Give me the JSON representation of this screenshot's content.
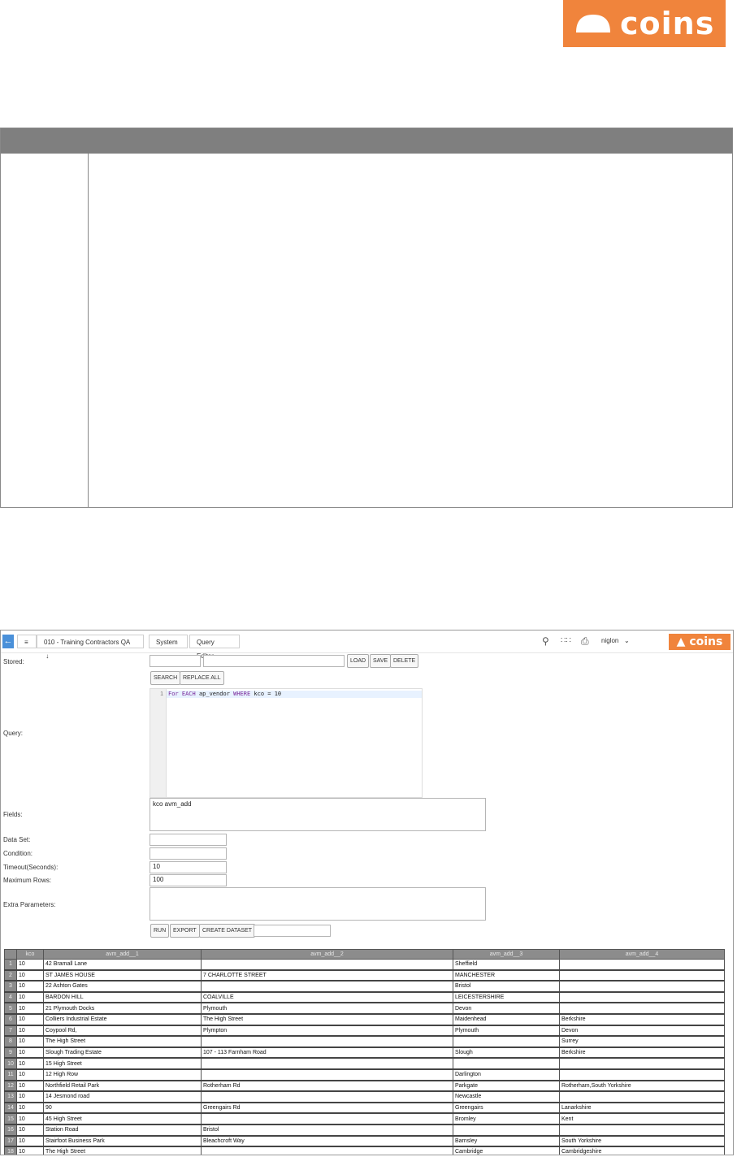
{
  "brand": {
    "name": "coins",
    "color": "#f0843c"
  },
  "editor_screen": {
    "topbar": {
      "breadcrumbs": [
        "010 - Training Contractors QA",
        "System",
        "Query Editor"
      ],
      "user": "niglon"
    },
    "form": {
      "stored_label": "Stored:",
      "load_label": "LOAD",
      "save_label": "SAVE",
      "delete_label": "DELETE",
      "search_label": "SEARCH",
      "replace_all_label": "REPLACE ALL",
      "query_label": "Query:",
      "query_line_number": "1",
      "query_parts": [
        "For",
        "EACH",
        "ap_vendor",
        "WHERE",
        "kco = 10"
      ],
      "fields_label": "Fields:",
      "fields_value": "kco avm_add",
      "dataset_label": "Data Set:",
      "condition_label": "Condition:",
      "timeout_label": "Timeout(Seconds):",
      "timeout_value": "10",
      "max_rows_label": "Maximum Rows:",
      "max_rows_value": "100",
      "extra_label": "Extra Parameters:",
      "run_label": "RUN",
      "export_label": "EXPORT",
      "create_dataset_label": "CREATE DATASET"
    },
    "results": {
      "columns": [
        "",
        "kco",
        "avm_add__1",
        "avm_add__2",
        "avm_add__3",
        "avm_add__4"
      ],
      "rows": [
        [
          "1",
          "10",
          "42 Bramall Lane",
          "",
          "Sheffield",
          ""
        ],
        [
          "2",
          "10",
          "ST JAMES HOUSE",
          "7 CHARLOTTE STREET",
          "MANCHESTER",
          ""
        ],
        [
          "3",
          "10",
          "22 Ashton Gates",
          "",
          "Bristol",
          ""
        ],
        [
          "4",
          "10",
          "BARDON HILL",
          "COALVILLE",
          "LEICESTERSHIRE",
          ""
        ],
        [
          "5",
          "10",
          "21 Plymouth Docks",
          "Plymouth",
          "Devon",
          ""
        ],
        [
          "6",
          "10",
          "Colliers Industrial Estate",
          "The High Street",
          "Maidenhead",
          "Berkshire"
        ],
        [
          "7",
          "10",
          "Coypool Rd,",
          "Plympton",
          "Plymouth",
          "Devon"
        ],
        [
          "8",
          "10",
          "The High Street",
          "",
          "",
          "Surrey"
        ],
        [
          "9",
          "10",
          "Slough Trading Estate",
          "107 - 113 Farnham Road",
          "Slough",
          "Berkshire"
        ],
        [
          "10",
          "10",
          "15 High Street",
          "",
          "",
          ""
        ],
        [
          "11",
          "10",
          "12 High Row",
          "",
          "Darlington",
          ""
        ],
        [
          "12",
          "10",
          "Northfield Retail Park",
          "Rotherham Rd",
          "Parkgate",
          "Rotherham,South Yorkshire"
        ],
        [
          "13",
          "10",
          "14 Jesmond road",
          "",
          "Newcastle",
          ""
        ],
        [
          "14",
          "10",
          "90",
          "Greengairs Rd",
          "Greengairs",
          "Lanarkshire"
        ],
        [
          "15",
          "10",
          "45 High Street",
          "",
          "Bromley",
          "Kent"
        ],
        [
          "16",
          "10",
          "Station Road",
          "Bristol",
          "",
          ""
        ],
        [
          "17",
          "10",
          "Stairfoot Business Park",
          "Bleachcroft Way",
          "Barnsley",
          "South Yorkshire"
        ],
        [
          "18",
          "10",
          "The High Street",
          "",
          "Cambridge",
          "Cambridgeshire"
        ]
      ]
    }
  }
}
